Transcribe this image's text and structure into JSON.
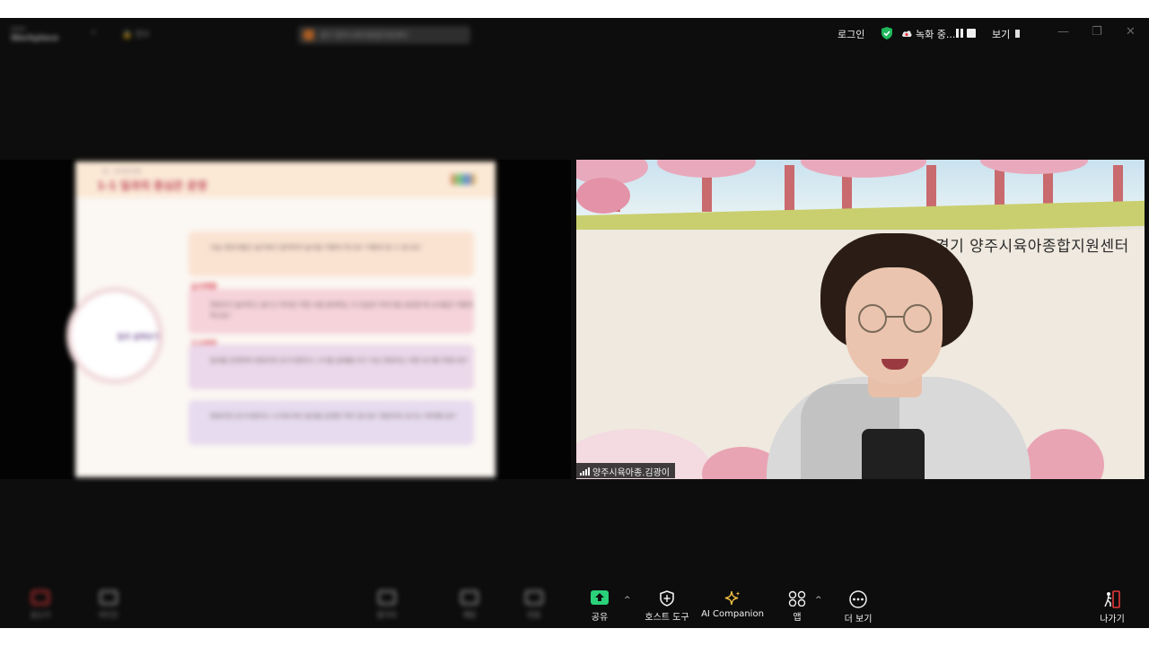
{
  "topbar": {
    "app_name": "Workplace",
    "app_small": "zoom",
    "meeting_pill_text": "경기 양주시육아종합지원센터",
    "login_label": "로그인",
    "recording_label": "녹화 중...",
    "view_label": "보기"
  },
  "shared_slide": {
    "subtitle": "01 · 보고회 운영",
    "title": "1-1 일과의 중심은 운영",
    "boxes": [
      "오늘 영유아들은 놀이에서 참여하여 놀이를 어떻게 하나요? 어떻게 할 수 있나요?",
      "영유아가 놀이하고 싶다고 하지만 어떤 사람 참여하는 지 모습의 이야기를 공유할 때 교사들은 어떻게 하나요?",
      "일과를 운영하며 영유아의 요구사항이나 시기를 살펴봅니다? 지난 영유아는 어떤 요구를 하였나요?",
      "영유아의 요구사항이나 시기에 따라 일과를 운영한 적이 있나요? 영유아의 요구는 어떠했나요?"
    ],
    "tags": [
      "교사역할",
      "교사역할"
    ],
    "circle_label": "일과 살펴보기"
  },
  "video": {
    "banner_text": "경기 양주시육아종합지원센터",
    "participant_name": "양주시육아종.김광이"
  },
  "toolbar": {
    "left_items": [
      "음소거",
      "비디오",
      "참가자",
      "채팅",
      "반응"
    ],
    "share_label": "공유",
    "host_tools_label": "호스트 도구",
    "ai_companion_label": "AI Companion",
    "apps_label": "앱",
    "more_label": "더 보기",
    "leave_label": "나가기"
  },
  "colors": {
    "share_green": "#2ad17a",
    "leave_red": "#e5383b",
    "shield_green": "#1fb75c",
    "ai_gold": "#f5c344"
  }
}
